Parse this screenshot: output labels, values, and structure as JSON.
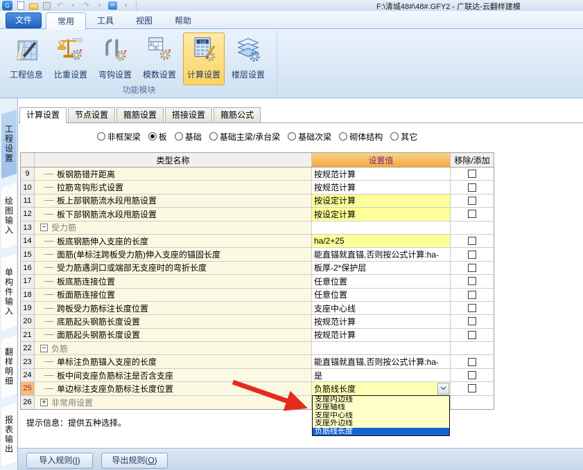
{
  "titlebar": {
    "title": "F:\\清城48#\\48#.GFY2 - 广联达-云翻样建模",
    "quick_icons": [
      "app-icon",
      "new-file-icon",
      "open-file-icon",
      "save-icon",
      "undo-icon",
      "undo-dropdown-icon",
      "redo-icon",
      "redo-dropdown-icon",
      "sync-icon",
      "sync-dropdown-icon"
    ]
  },
  "ribbon": {
    "file_tab": "文件",
    "tabs": [
      {
        "label": "常用",
        "active": true
      },
      {
        "label": "工具",
        "active": false
      },
      {
        "label": "视图",
        "active": false
      },
      {
        "label": "帮助",
        "active": false
      }
    ],
    "buttons": [
      {
        "label": "工程信息",
        "icon": "project-info-icon",
        "active": false
      },
      {
        "label": "比重设置",
        "icon": "unit-weight-icon",
        "active": false
      },
      {
        "label": "弯钩设置",
        "icon": "hook-icon",
        "active": false
      },
      {
        "label": "模数设置",
        "icon": "modulus-icon",
        "active": false
      },
      {
        "label": "计算设置",
        "icon": "calc-settings-icon",
        "active": true
      },
      {
        "label": "楼层设置",
        "icon": "floor-settings-icon",
        "active": false
      }
    ],
    "group_label": "功能模块"
  },
  "side_tabs": [
    {
      "label": "工程设置",
      "active": true
    },
    {
      "label": "绘图输入",
      "active": false
    },
    {
      "label": "单构件输入",
      "active": false
    },
    {
      "label": "翻样明细",
      "active": false
    },
    {
      "label": "报表输出",
      "active": false
    }
  ],
  "doc_tabs": [
    {
      "label": "计算设置",
      "active": true
    },
    {
      "label": "节点设置",
      "active": false
    },
    {
      "label": "箍筋设置",
      "active": false
    },
    {
      "label": "搭接设置",
      "active": false
    },
    {
      "label": "箍筋公式",
      "active": false
    }
  ],
  "radios": {
    "options": [
      {
        "label": "非框架梁",
        "selected": false
      },
      {
        "label": "板",
        "selected": true
      },
      {
        "label": "基础",
        "selected": false
      },
      {
        "label": "基础主梁/承台梁",
        "selected": false
      },
      {
        "label": "基础次梁",
        "selected": false
      },
      {
        "label": "砌体结构",
        "selected": false
      },
      {
        "label": "其它",
        "selected": false
      }
    ]
  },
  "table": {
    "headers": {
      "name": "类型名称",
      "value": "设置值",
      "action": "移除/添加"
    },
    "rows": [
      {
        "num": "9",
        "type": "item",
        "label": "板钢筋错开距离",
        "value": "按规范计算",
        "vh": false,
        "cb": true
      },
      {
        "num": "10",
        "type": "item",
        "label": "拉筋弯钩形式设置",
        "value": "按规范计算",
        "vh": false,
        "cb": true
      },
      {
        "num": "11",
        "type": "item",
        "label": "板上部钢筋流水段甩筋设置",
        "value": "按设定计算",
        "vh": true,
        "cb": true
      },
      {
        "num": "12",
        "type": "item",
        "label": "板下部钢筋流水段甩筋设置",
        "value": "按设定计算",
        "vh": true,
        "cb": true
      },
      {
        "num": "13",
        "type": "group",
        "expanded": true,
        "label": "受力筋"
      },
      {
        "num": "14",
        "type": "item",
        "label": "板底钢筋伸入支座的长度",
        "value": "ha/2+25",
        "vh": true,
        "cb": true
      },
      {
        "num": "15",
        "type": "item",
        "label": "面筋(单标注跨板受力筋)伸入支座的锚固长度",
        "value": "能直锚就直锚,否则按公式计算:ha-",
        "vh": false,
        "cb": true
      },
      {
        "num": "16",
        "type": "item",
        "label": "受力筋遇洞口或端部无支座时的弯折长度",
        "value": "板厚-2*保护层",
        "vh": false,
        "cb": true
      },
      {
        "num": "17",
        "type": "item",
        "label": "板底筋连接位置",
        "value": "任意位置",
        "vh": false,
        "cb": true
      },
      {
        "num": "18",
        "type": "item",
        "label": "板面筋连接位置",
        "value": "任意位置",
        "vh": false,
        "cb": true
      },
      {
        "num": "19",
        "type": "item",
        "label": "跨板受力筋标注长度位置",
        "value": "支座中心线",
        "vh": false,
        "cb": true
      },
      {
        "num": "20",
        "type": "item",
        "label": "底筋起头钢筋长度设置",
        "value": "按规范计算",
        "vh": false,
        "cb": true
      },
      {
        "num": "21",
        "type": "item",
        "label": "面筋起头钢筋长度设置",
        "value": "按规范计算",
        "vh": false,
        "cb": true
      },
      {
        "num": "22",
        "type": "group",
        "expanded": true,
        "label": "负筋"
      },
      {
        "num": "23",
        "type": "item",
        "label": "单标注负筋锚入支座的长度",
        "value": "能直锚就直锚,否则按公式计算:ha-",
        "vh": false,
        "cb": true
      },
      {
        "num": "24",
        "type": "item",
        "label": "板中间支座负筋标注是否含支座",
        "value": "是",
        "vh": false,
        "cb": true
      },
      {
        "num": "25",
        "type": "item",
        "label": "单边标注支座负筋标注长度位置",
        "value": "负筋线长度",
        "vh": true,
        "cb": true,
        "combo": true,
        "num_hl": true
      },
      {
        "num": "26",
        "type": "group",
        "expanded": false,
        "label": "非常用设置"
      }
    ]
  },
  "dropdown": {
    "items": [
      "支座内边线",
      "支座轴线",
      "支座中心线",
      "支座外边线",
      "负筋线长度"
    ],
    "selected_index": 4
  },
  "hint": "提示信息：提供五种选择。",
  "footer": {
    "buttons": [
      {
        "prefix": "导入规则(",
        "key": "I",
        "suffix": ")"
      },
      {
        "prefix": "导出规则(",
        "key": "O",
        "suffix": ")"
      }
    ]
  },
  "colors": {
    "selection_blue": "#1464d2",
    "highlight_yellow": "#ffff99",
    "combo_yellow": "#ffffb4",
    "value_header_orange": "#f3a93d",
    "header_text_purple": "#7b2982",
    "row25_num_bg": "#f6b97f",
    "arrow_red": "#e32b1e",
    "active_ribbon_button": "#fbd463"
  }
}
